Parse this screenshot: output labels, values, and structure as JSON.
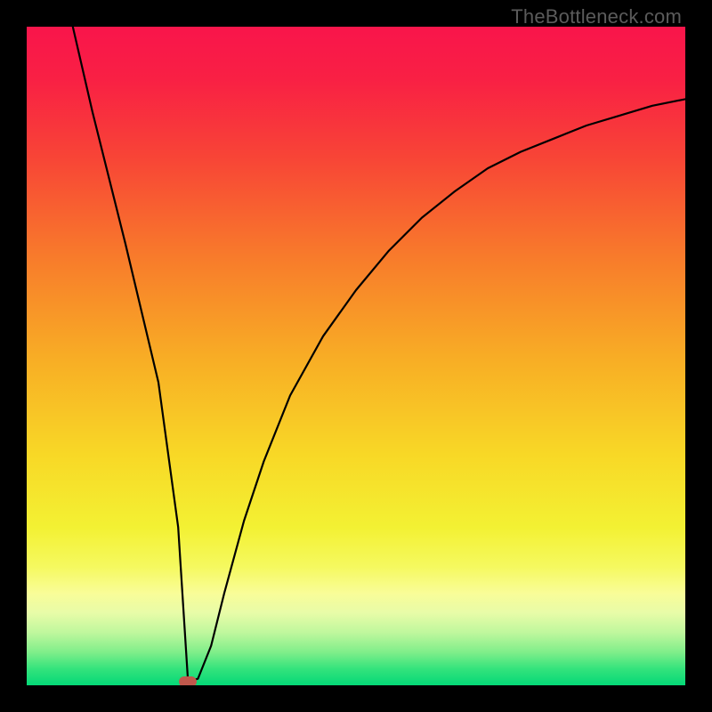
{
  "watermark": "TheBottleneck.com",
  "chart_data": {
    "type": "line",
    "title": "",
    "xlabel": "",
    "ylabel": "",
    "xlim": [
      0,
      100
    ],
    "ylim": [
      0,
      100
    ],
    "grid": false,
    "legend": false,
    "series": [
      {
        "name": "bottleneck-curve",
        "x": [
          7,
          10,
          15,
          20,
          23,
          24.5,
          26,
          28,
          30,
          33,
          36,
          40,
          45,
          50,
          55,
          60,
          65,
          70,
          75,
          80,
          85,
          90,
          95,
          100
        ],
        "y": [
          100,
          87,
          67,
          46,
          24,
          0.5,
          1,
          6,
          14,
          25,
          34,
          44,
          53,
          60,
          66,
          71,
          75,
          78.5,
          81,
          83,
          85,
          86.5,
          88,
          89
        ]
      }
    ],
    "marker": {
      "x": 24.5,
      "y": 0.5,
      "color": "#c0584c"
    },
    "gradient_stops": [
      {
        "offset": 0.0,
        "color": "#f9154b"
      },
      {
        "offset": 0.08,
        "color": "#f92044"
      },
      {
        "offset": 0.2,
        "color": "#f84536"
      },
      {
        "offset": 0.35,
        "color": "#f87b2b"
      },
      {
        "offset": 0.5,
        "color": "#f8ac25"
      },
      {
        "offset": 0.65,
        "color": "#f8d826"
      },
      {
        "offset": 0.76,
        "color": "#f3f133"
      },
      {
        "offset": 0.82,
        "color": "#f5f95f"
      },
      {
        "offset": 0.86,
        "color": "#f9fd98"
      },
      {
        "offset": 0.89,
        "color": "#e8fca8"
      },
      {
        "offset": 0.92,
        "color": "#bff79d"
      },
      {
        "offset": 0.95,
        "color": "#7fee8a"
      },
      {
        "offset": 0.975,
        "color": "#34e37c"
      },
      {
        "offset": 1.0,
        "color": "#04d877"
      }
    ]
  }
}
